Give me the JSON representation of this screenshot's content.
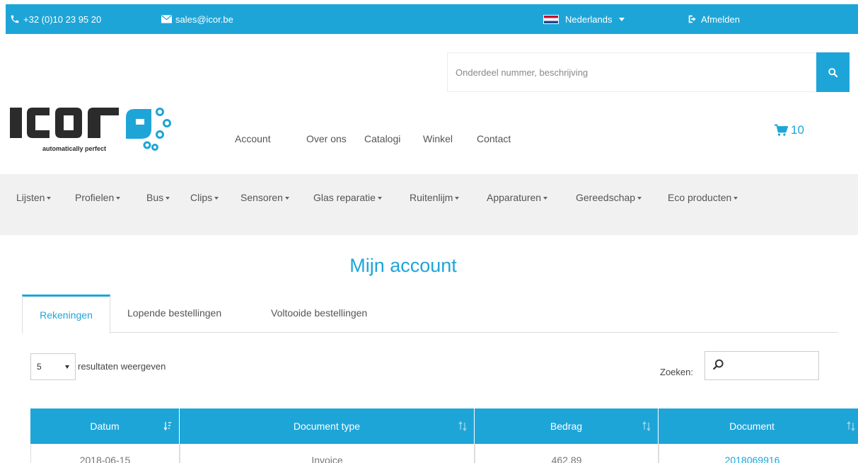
{
  "topbar": {
    "phone": "+32 (0)10 23 95 20",
    "email": "sales@icor.be",
    "language": "Nederlands",
    "logout": "Afmelden"
  },
  "search": {
    "placeholder": "Onderdeel nummer, beschrijving"
  },
  "logo": {
    "tagline": "automatically perfect"
  },
  "mainnav": {
    "items": [
      "Account",
      "Over ons",
      "Catalogi",
      "Winkel",
      "Contact"
    ]
  },
  "cart": {
    "count": "10"
  },
  "categories": [
    "Lijsten",
    "Profielen",
    "Bus",
    "Clips",
    "Sensoren",
    "Glas reparatie",
    "Ruitenlijm",
    "Apparaturen",
    "Gereedschap",
    "Eco producten"
  ],
  "account": {
    "title": "Mijn account",
    "tabs": [
      "Rekeningen",
      "Lopende bestellingen",
      "Voltooide bestellingen"
    ]
  },
  "table_controls": {
    "length_value": "5",
    "length_label": "resultaten weergeven",
    "search_label": "Zoeken:"
  },
  "table": {
    "columns": [
      "Datum",
      "Document type",
      "Bedrag",
      "Document"
    ],
    "rows": [
      [
        "2018-06-15",
        "Invoice",
        "462.89",
        "2018069916"
      ]
    ]
  },
  "colors": {
    "accent": "#1ea5d8",
    "category_bar": "#f1f1f1"
  }
}
